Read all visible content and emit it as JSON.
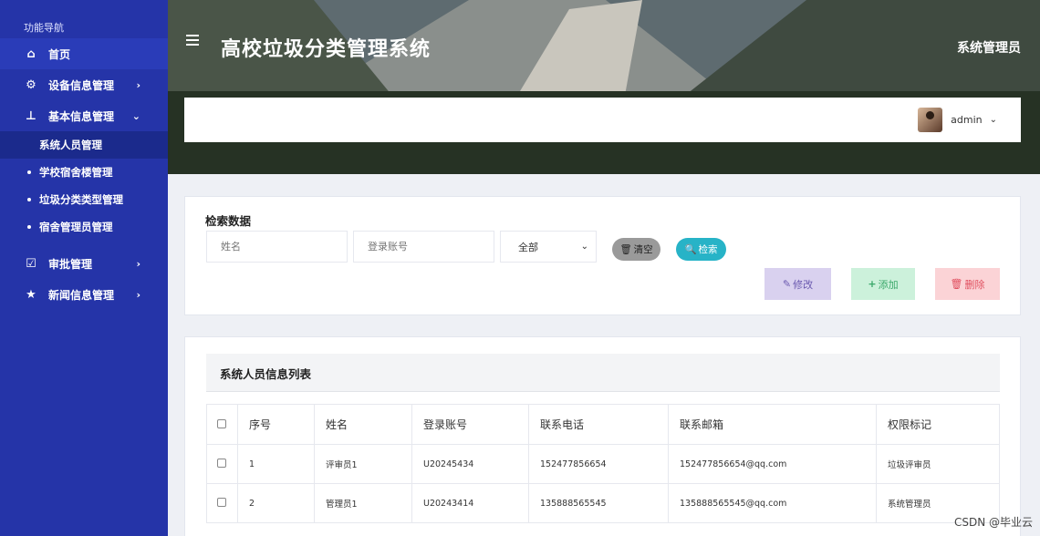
{
  "sidebar": {
    "title": "功能导航",
    "items": [
      {
        "label": "首页"
      },
      {
        "label": "设备信息管理"
      },
      {
        "label": "基本信息管理"
      },
      {
        "label": "审批管理"
      },
      {
        "label": "新闻信息管理"
      }
    ],
    "sub_items": [
      {
        "label": "系统人员管理"
      },
      {
        "label": "学校宿舍楼管理"
      },
      {
        "label": "垃圾分类类型管理"
      },
      {
        "label": "宿舍管理员管理"
      }
    ]
  },
  "header": {
    "title": "高校垃圾分类管理系统",
    "role": "系统管理员",
    "user": "admin"
  },
  "search": {
    "title": "检索数据",
    "name_placeholder": "姓名",
    "account_placeholder": "登录账号",
    "select_value": "全部",
    "clear_label": "清空",
    "search_label": "检索",
    "edit_label": "修改",
    "add_label": "添加",
    "delete_label": "删除"
  },
  "table": {
    "title": "系统人员信息列表",
    "columns": [
      "序号",
      "姓名",
      "登录账号",
      "联系电话",
      "联系邮箱",
      "权限标记"
    ],
    "rows": [
      [
        "1",
        "评审员1",
        "U20245434",
        "152477856654",
        "152477856654@qq.com",
        "垃圾评审员"
      ],
      [
        "2",
        "管理员1",
        "U20243414",
        "135888565545",
        "135888565545@qq.com",
        "系统管理员"
      ]
    ]
  },
  "watermark": "CSDN @毕业云"
}
